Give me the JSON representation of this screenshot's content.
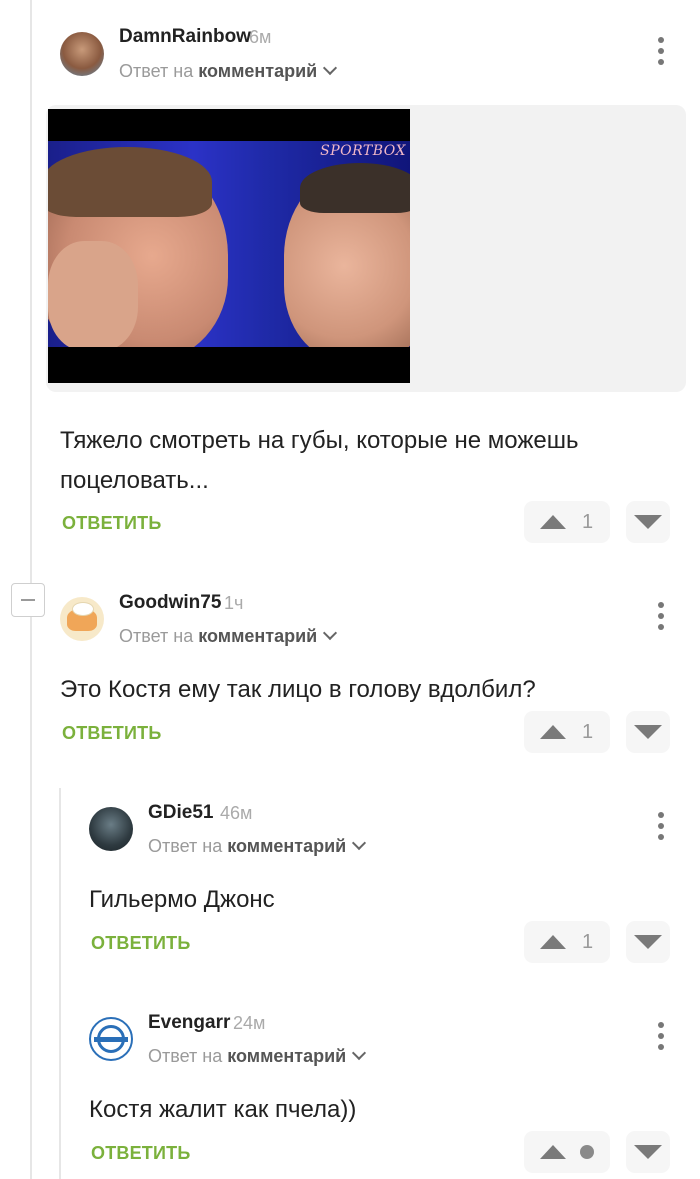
{
  "comments": [
    {
      "username": "DamnRainbow",
      "time": "6м",
      "reply_prefix": "Ответ на",
      "reply_target": "комментарий",
      "text": "Тяжело смотреть на губы, которые не можешь поцеловать...",
      "reply_label": "ОТВЕТИТЬ",
      "votes": "1",
      "media": {
        "logo": "SPORTBOX"
      }
    },
    {
      "username": "Goodwin75",
      "time": "1ч",
      "reply_prefix": "Ответ на",
      "reply_target": "комментарий",
      "text": "Это Костя ему так лицо в голову вдолбил?",
      "reply_label": "ОТВЕТИТЬ",
      "votes": "1"
    },
    {
      "username": "GDie51",
      "time": "46м",
      "reply_prefix": "Ответ на",
      "reply_target": "комментарий",
      "text": "Гильермо Джонс",
      "reply_label": "ОТВЕТИТЬ",
      "votes": "1"
    },
    {
      "username": "Evengarr",
      "time": "24м",
      "reply_prefix": "Ответ на",
      "reply_target": "комментарий",
      "text": "Костя жалит как пчела))",
      "reply_label": "ОТВЕТИТЬ",
      "votes": ""
    }
  ],
  "colors": {
    "accent_green": "#7bb13c",
    "text": "#222222",
    "muted": "#9a9a9a"
  },
  "icons": [
    "more-vertical-icon",
    "chevron-down-icon",
    "upvote-icon",
    "downvote-icon",
    "collapse-icon"
  ]
}
